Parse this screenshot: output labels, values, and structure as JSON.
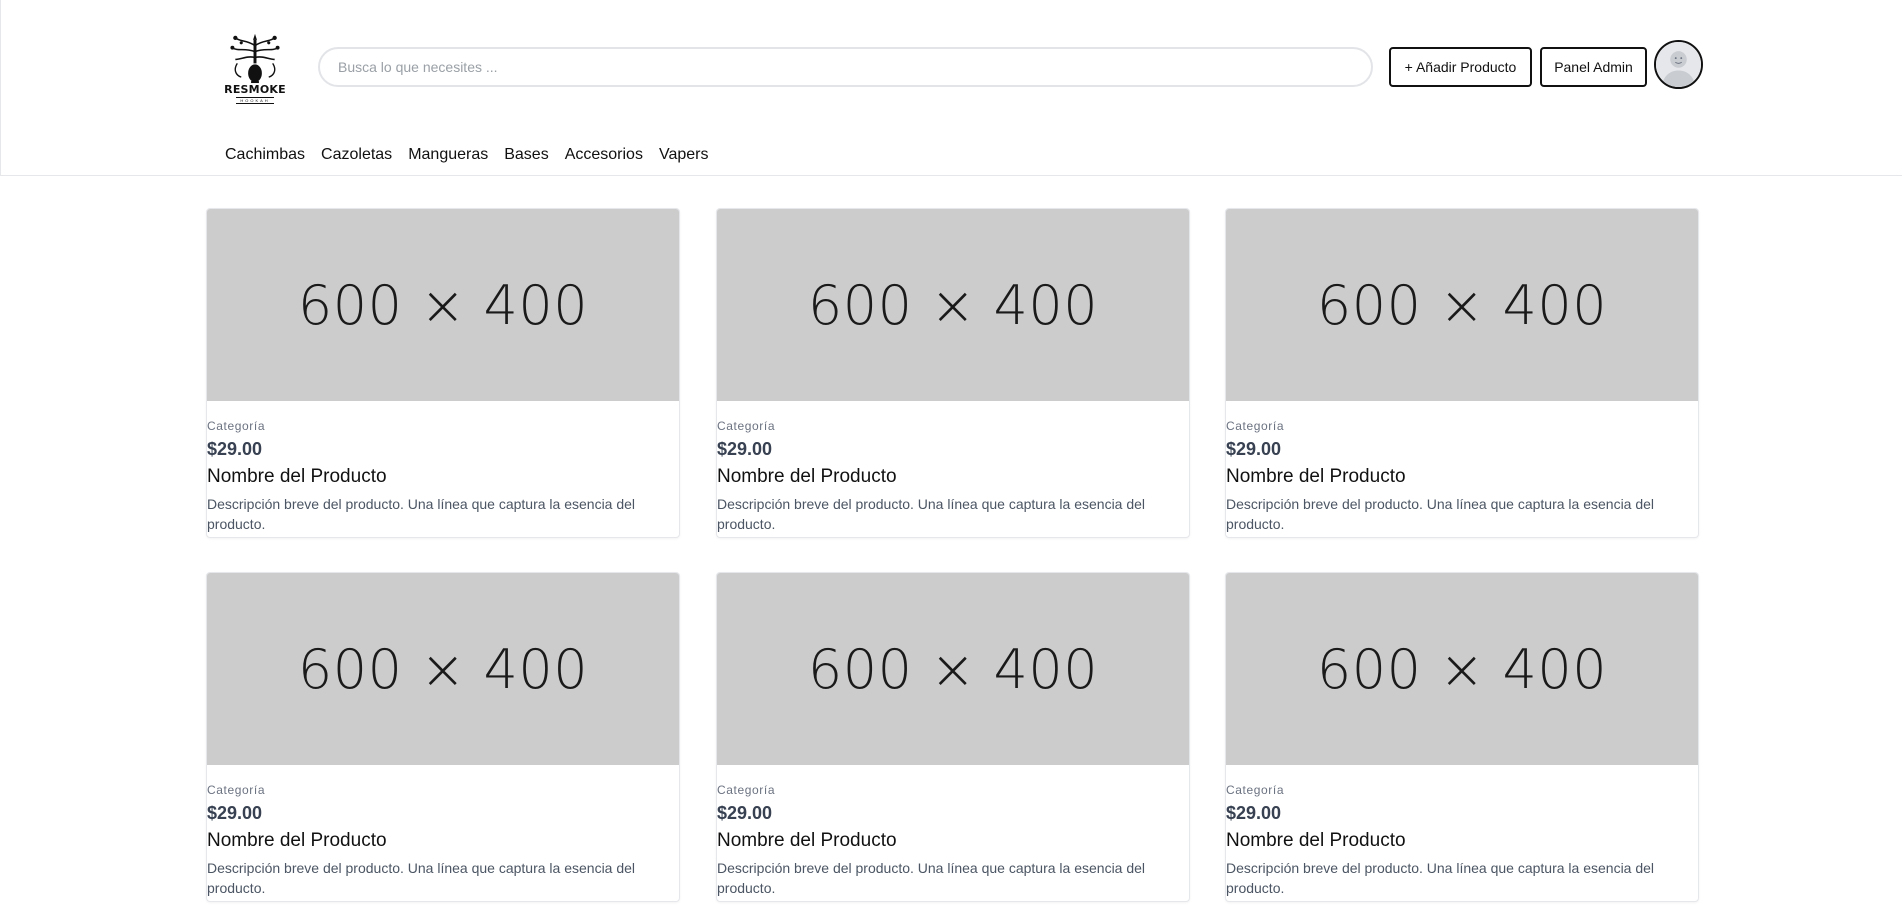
{
  "header": {
    "logo_text": "RESMOKE",
    "logo_sub": "HOOKAH",
    "search_placeholder": "Busca lo que necesites ...",
    "add_product_label": "+ Añadir Producto",
    "admin_panel_label": "Panel Admin"
  },
  "nav": {
    "items": [
      {
        "label": "Cachimbas"
      },
      {
        "label": "Cazoletas"
      },
      {
        "label": "Mangueras"
      },
      {
        "label": "Bases"
      },
      {
        "label": "Accesorios"
      },
      {
        "label": "Vapers"
      }
    ]
  },
  "products": [
    {
      "image_label": "600 × 400",
      "category": "Categoría",
      "price": "$29.00",
      "name": "Nombre del Producto",
      "description": "Descripción breve del producto. Una línea que captura la esencia del producto."
    },
    {
      "image_label": "600 × 400",
      "category": "Categoría",
      "price": "$29.00",
      "name": "Nombre del Producto",
      "description": "Descripción breve del producto. Una línea que captura la esencia del producto."
    },
    {
      "image_label": "600 × 400",
      "category": "Categoría",
      "price": "$29.00",
      "name": "Nombre del Producto",
      "description": "Descripción breve del producto. Una línea que captura la esencia del producto."
    },
    {
      "image_label": "600 × 400",
      "category": "Categoría",
      "price": "$29.00",
      "name": "Nombre del Producto",
      "description": "Descripción breve del producto. Una línea que captura la esencia del producto."
    },
    {
      "image_label": "600 × 400",
      "category": "Categoría",
      "price": "$29.00",
      "name": "Nombre del Producto",
      "description": "Descripción breve del producto. Una línea que captura la esencia del producto."
    },
    {
      "image_label": "600 × 400",
      "category": "Categoría",
      "price": "$29.00",
      "name": "Nombre del Producto",
      "description": "Descripción breve del producto. Una línea que captura la esencia del producto."
    }
  ],
  "icons": {
    "logo": "hookah-tree-logo-icon",
    "avatar": "user-avatar-icon"
  }
}
